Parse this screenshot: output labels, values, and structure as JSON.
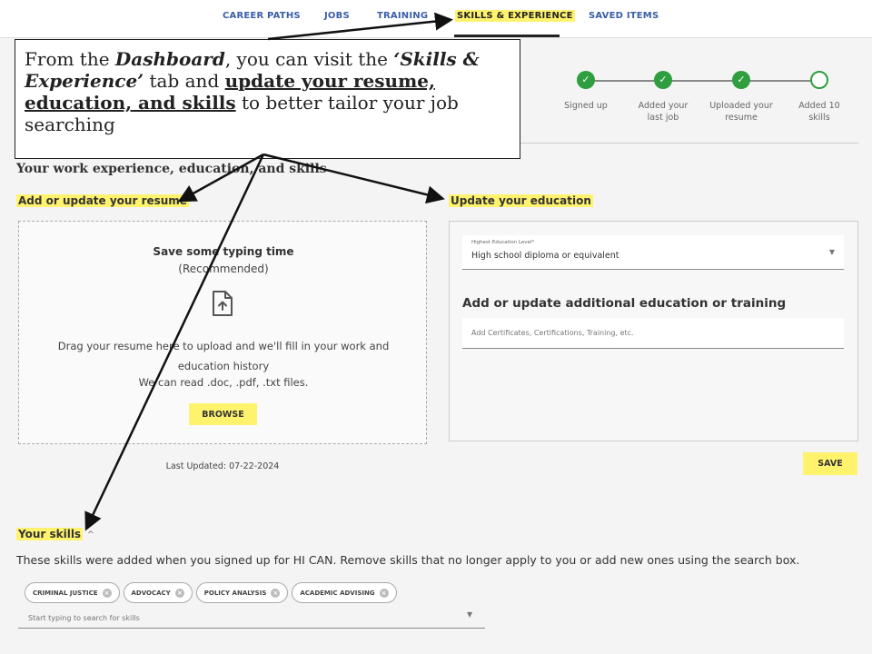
{
  "nav": {
    "tabs": [
      {
        "label": "CAREER PATHS"
      },
      {
        "label": "JOBS"
      },
      {
        "label": "TRAINING"
      },
      {
        "label": "SKILLS & EXPERIENCE"
      },
      {
        "label": "SAVED ITEMS"
      }
    ],
    "active_tab": "SKILLS & EXPERIENCE"
  },
  "callout": {
    "t1": "From the ",
    "t2": "Dashboard",
    "t3": ", you can visit the ",
    "t4": "‘Skills & Experience’",
    "t5": " tab and ",
    "t6": "update your resume, education, and skills",
    "t7": " to better tailor your job searching"
  },
  "progress": {
    "steps": [
      {
        "label": "Signed up",
        "done": true
      },
      {
        "label": "Added your last job",
        "done": true
      },
      {
        "label": "Uploaded your resume",
        "done": true
      },
      {
        "label": "Added 10 skills",
        "done": false
      }
    ],
    "check_glyph": "✓",
    "accent_color": "#2e9e3e"
  },
  "section_title": "Your work experience, education, and skills",
  "resume": {
    "heading": "Add or update your resume",
    "title": "Save some typing time",
    "subtitle": "(Recommended)",
    "icon": "file-upload-icon",
    "drag_text": "Drag your resume here to upload and we'll fill in your work and education history",
    "file_types": "We can read .doc, .pdf, .txt files.",
    "browse_label": "BROWSE",
    "last_updated": "Last Updated: 07-22-2024"
  },
  "education": {
    "heading": "Update your education",
    "select_label": "Highest Education Level*",
    "select_value": "High school diploma or equivalent",
    "add_title": "Add or update additional education or training",
    "add_placeholder": "Add Certificates, Certifications, Training, etc.",
    "save_label": "SAVE"
  },
  "skills": {
    "heading": "Your skills",
    "description": "These skills were added when you signed up for HI CAN. Remove skills that no longer apply to you or add new ones using the search box.",
    "chips": [
      {
        "label": "CRIMINAL JUSTICE"
      },
      {
        "label": "ADVOCACY"
      },
      {
        "label": "POLICY ANALYSIS"
      },
      {
        "label": "ACADEMIC ADVISING"
      }
    ],
    "search_placeholder": "Start typing to search for skills"
  },
  "colors": {
    "highlight": "#fff36e",
    "link_blue": "#3b5ea8"
  }
}
